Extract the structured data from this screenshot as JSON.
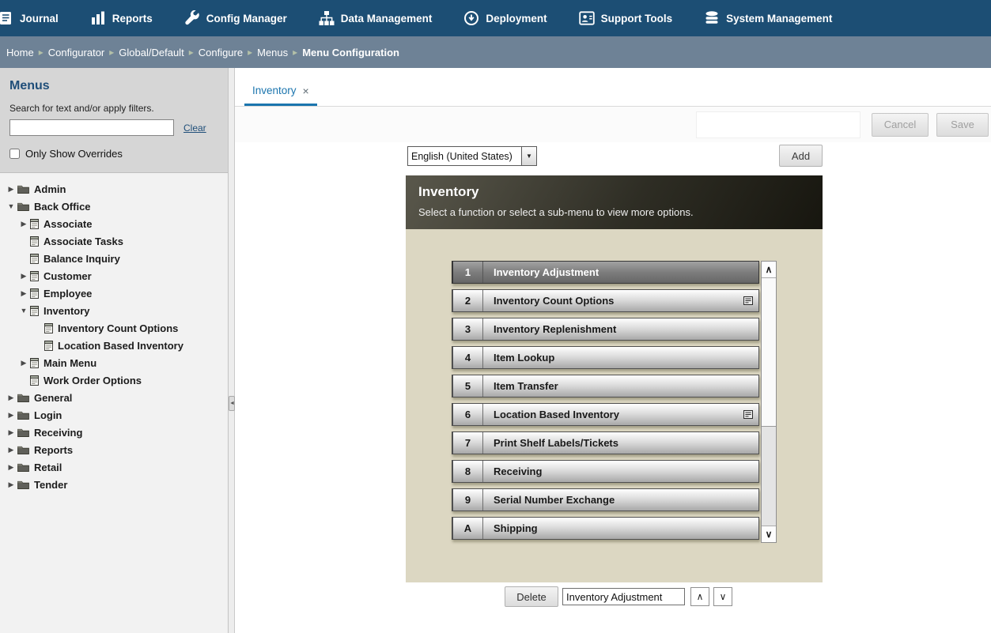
{
  "icons": {
    "close": "×",
    "tree_collapsed": "▶",
    "tree_expanded": "▼",
    "crumb_sep": "▸",
    "select_arrow": "▼",
    "scroll_up": "∧",
    "scroll_down": "∨",
    "move_up": "∧",
    "move_down": "∨",
    "collapse_handle": "◄"
  },
  "topnav": {
    "items": [
      {
        "label": "Journal",
        "icon": "journal-icon"
      },
      {
        "label": "Reports",
        "icon": "reports-icon"
      },
      {
        "label": "Config Manager",
        "icon": "wrench-icon"
      },
      {
        "label": "Data Management",
        "icon": "hierarchy-icon"
      },
      {
        "label": "Deployment",
        "icon": "deploy-icon"
      },
      {
        "label": "Support Tools",
        "icon": "support-person-icon"
      },
      {
        "label": "System Management",
        "icon": "database-icon"
      }
    ]
  },
  "breadcrumb": [
    "Home",
    "Configurator",
    "Global/Default",
    "Configure",
    "Menus",
    "Menu Configuration"
  ],
  "sidebar": {
    "title": "Menus",
    "search_hint": "Search for text and/or apply filters.",
    "search_value": "",
    "clear_label": "Clear",
    "overrides_label": "Only Show Overrides",
    "tree": [
      {
        "label": "Admin",
        "type": "folder",
        "state": "collapsed",
        "level": 0
      },
      {
        "label": "Back Office",
        "type": "folder",
        "state": "expanded",
        "level": 0
      },
      {
        "label": "Associate",
        "type": "document",
        "state": "collapsed",
        "level": 1
      },
      {
        "label": "Associate Tasks",
        "type": "document",
        "state": "leaf",
        "level": 1
      },
      {
        "label": "Balance Inquiry",
        "type": "document",
        "state": "leaf",
        "level": 1
      },
      {
        "label": "Customer",
        "type": "document",
        "state": "collapsed",
        "level": 1
      },
      {
        "label": "Employee",
        "type": "document",
        "state": "collapsed",
        "level": 1
      },
      {
        "label": "Inventory",
        "type": "document",
        "state": "expanded",
        "level": 1
      },
      {
        "label": "Inventory Count Options",
        "type": "document",
        "state": "leaf",
        "level": 2
      },
      {
        "label": "Location Based Inventory",
        "type": "document",
        "state": "leaf",
        "level": 2
      },
      {
        "label": "Main Menu",
        "type": "document",
        "state": "collapsed",
        "level": 1
      },
      {
        "label": "Work Order Options",
        "type": "document",
        "state": "leaf",
        "level": 1
      },
      {
        "label": "General",
        "type": "folder",
        "state": "collapsed",
        "level": 0
      },
      {
        "label": "Login",
        "type": "folder",
        "state": "collapsed",
        "level": 0
      },
      {
        "label": "Receiving",
        "type": "folder",
        "state": "collapsed",
        "level": 0
      },
      {
        "label": "Reports",
        "type": "folder",
        "state": "collapsed",
        "level": 0
      },
      {
        "label": "Retail",
        "type": "folder",
        "state": "collapsed",
        "level": 0
      },
      {
        "label": "Tender",
        "type": "folder",
        "state": "collapsed",
        "level": 0
      }
    ]
  },
  "main": {
    "tab_label": "Inventory",
    "cancel_label": "Cancel",
    "save_label": "Save",
    "language_value": "English (United States)",
    "add_label": "Add",
    "preview": {
      "title": "Inventory",
      "subtitle": "Select a function or select a sub-menu to view more options.",
      "menu_items": [
        {
          "key": "1",
          "label": "Inventory Adjustment",
          "selected": true,
          "has_submenu": false
        },
        {
          "key": "2",
          "label": "Inventory Count Options",
          "selected": false,
          "has_submenu": true
        },
        {
          "key": "3",
          "label": "Inventory Replenishment",
          "selected": false,
          "has_submenu": false
        },
        {
          "key": "4",
          "label": "Item Lookup",
          "selected": false,
          "has_submenu": false
        },
        {
          "key": "5",
          "label": "Item Transfer",
          "selected": false,
          "has_submenu": false
        },
        {
          "key": "6",
          "label": "Location Based Inventory",
          "selected": false,
          "has_submenu": true
        },
        {
          "key": "7",
          "label": "Print Shelf Labels/Tickets",
          "selected": false,
          "has_submenu": false
        },
        {
          "key": "8",
          "label": "Receiving",
          "selected": false,
          "has_submenu": false
        },
        {
          "key": "9",
          "label": "Serial Number Exchange",
          "selected": false,
          "has_submenu": false
        },
        {
          "key": "A",
          "label": "Shipping",
          "selected": false,
          "has_submenu": false
        }
      ]
    },
    "footer": {
      "delete_label": "Delete",
      "selected_value": "Inventory Adjustment"
    }
  }
}
